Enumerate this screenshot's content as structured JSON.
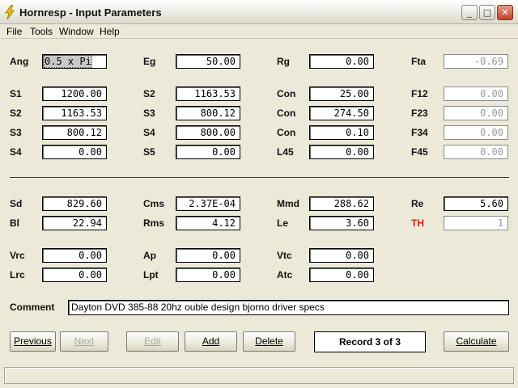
{
  "window": {
    "title": "Hornresp - Input Parameters",
    "buttons": {
      "minimize": "_",
      "maximize": "□",
      "close": "✕"
    }
  },
  "menu": [
    "File",
    "Tools",
    "Window",
    "Help"
  ],
  "params": {
    "ang": {
      "label": "Ang",
      "value": "0.5 x Pi"
    },
    "eg": {
      "label": "Eg",
      "value": "50.00"
    },
    "rg": {
      "label": "Rg",
      "value": "0.00"
    },
    "fta": {
      "label": "Fta",
      "value": "-0.69"
    },
    "s1": {
      "label": "S1",
      "value": "1200.00"
    },
    "s2a": {
      "label": "S2",
      "value": "1163.53"
    },
    "con1": {
      "label": "Con",
      "value": "25.00"
    },
    "f12": {
      "label": "F12",
      "value": "0.00"
    },
    "s2b": {
      "label": "S2",
      "value": "1163.53"
    },
    "s3a": {
      "label": "S3",
      "value": "800.12"
    },
    "con2": {
      "label": "Con",
      "value": "274.50"
    },
    "f23": {
      "label": "F23",
      "value": "0.00"
    },
    "s3b": {
      "label": "S3",
      "value": "800.12"
    },
    "s4a": {
      "label": "S4",
      "value": "800.00"
    },
    "con3": {
      "label": "Con",
      "value": "0.10"
    },
    "f34": {
      "label": "F34",
      "value": "0.00"
    },
    "s4b": {
      "label": "S4",
      "value": "0.00"
    },
    "s5": {
      "label": "S5",
      "value": "0.00"
    },
    "l45": {
      "label": "L45",
      "value": "0.00"
    },
    "f45": {
      "label": "F45",
      "value": "0.00"
    },
    "sd": {
      "label": "Sd",
      "value": "829.60"
    },
    "cms": {
      "label": "Cms",
      "value": "2.37E-04"
    },
    "mmd": {
      "label": "Mmd",
      "value": "288.62"
    },
    "re": {
      "label": "Re",
      "value": "5.60"
    },
    "bl": {
      "label": "Bl",
      "value": "22.94"
    },
    "rms": {
      "label": "Rms",
      "value": "4.12"
    },
    "le": {
      "label": "Le",
      "value": "3.60"
    },
    "th": {
      "label": "TH",
      "value": "1"
    },
    "vrc": {
      "label": "Vrc",
      "value": "0.00"
    },
    "ap": {
      "label": "Ap",
      "value": "0.00"
    },
    "vtc": {
      "label": "Vtc",
      "value": "0.00"
    },
    "lrc": {
      "label": "Lrc",
      "value": "0.00"
    },
    "lpt": {
      "label": "Lpt",
      "value": "0.00"
    },
    "atc": {
      "label": "Atc",
      "value": "0.00"
    }
  },
  "comment": {
    "label": "Comment",
    "value": "Dayton DVD 385-88 20hz ouble design bjorno driver specs"
  },
  "buttons": {
    "previous": "Previous",
    "next": "Next",
    "edit": "Edit",
    "add": "Add",
    "delete": "Delete",
    "record": "Record 3 of 3",
    "calculate": "Calculate"
  },
  "colors": {
    "th_label": "#d42020",
    "window_bg": "#ece9d8"
  }
}
